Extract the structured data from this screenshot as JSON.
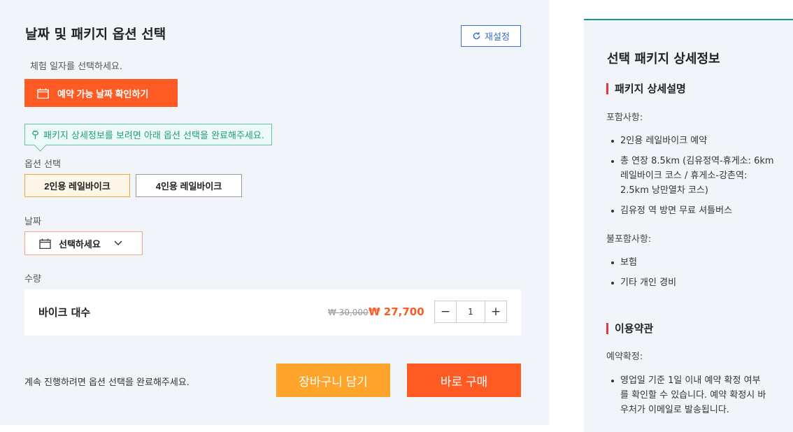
{
  "left": {
    "title": "날짜 및 패키지 옵션 선택",
    "reset_label": "재설정",
    "date_hint": "체험 일자를 선택하세요.",
    "check_date_label": "예약 가능 날짜 확인하기",
    "tooltip": "패키지 상세정보를 보려면 아래 옵션 선택을 완료해주세요.",
    "option_label": "옵션 선택",
    "options": [
      {
        "label": "2인용 레일바이크",
        "selected": true
      },
      {
        "label": "4인용 레일바이크",
        "selected": false
      }
    ],
    "date_label": "날짜",
    "date_placeholder": "선택하세요",
    "qty_label": "수량",
    "qty_item": "바이크 대수",
    "price_old": "₩ 30,000",
    "price_new": "₩ 27,700",
    "qty_value": "1",
    "minus": "−",
    "plus": "+",
    "bottom_note": "계속 진행하려면 옵션 선택을 완료해주세요.",
    "cart_label": "장바구니 담기",
    "buy_label": "바로 구매"
  },
  "right": {
    "title": "선택 패키지 상세정보",
    "package_heading": "패키지 상세설명",
    "included_label": "포함사항:",
    "included": [
      "2인용 레일바이크 예약",
      "총 연장 8.5km (김유정역-휴게소: 6km 레일바이크 코스 / 휴게소-강촌역: 2.5km 낭만열차 코스)",
      "김유정 역 방면 무료 셔틀버스"
    ],
    "excluded_label": "불포함사항:",
    "excluded": [
      "보험",
      "기타 개인 경비"
    ],
    "terms_heading": "이용약관",
    "confirm_label": "예약확정:",
    "confirm_items": [
      "영업일 기준 1일 이내 예약 확정 여부를 확인할 수 있습니다. 예약 확정시 바우처가 이메일로 발송됩니다."
    ]
  },
  "colors": {
    "primary_orange": "#fe5a23",
    "cart_yellow": "#fea42a",
    "accent_green": "#15997a",
    "link_blue": "#3b6fd8",
    "heading_red": "#e2393e"
  },
  "icons": {
    "reset": "refresh-icon",
    "calendar": "calendar-icon",
    "tooltip": "clover-icon",
    "chevron": "chevron-down-icon"
  }
}
